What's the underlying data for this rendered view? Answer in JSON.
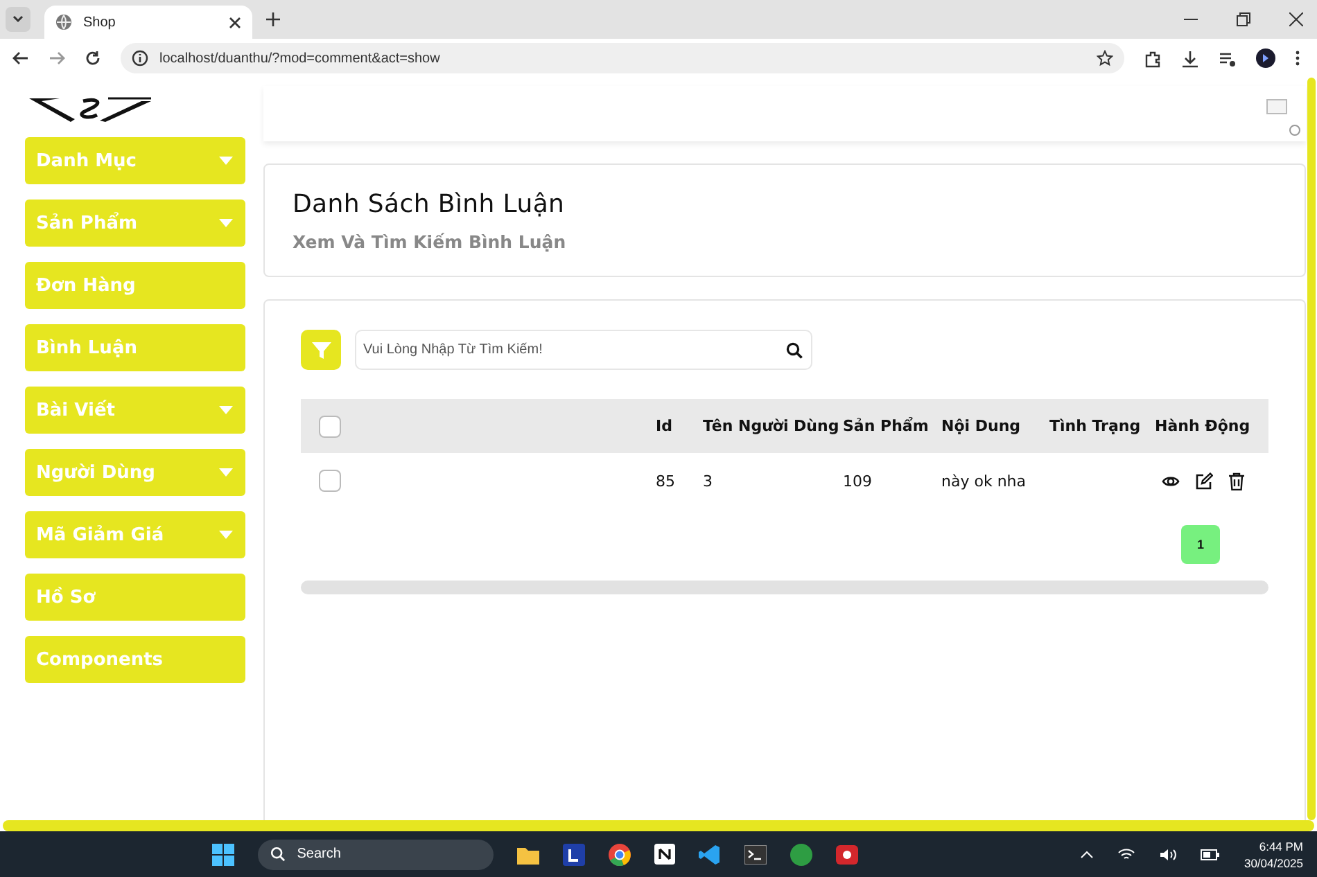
{
  "browser": {
    "tab_title": "Shop",
    "url": "localhost/duanthu/?mod=comment&act=show"
  },
  "sidebar": {
    "items": [
      {
        "label": "Danh Mục",
        "has_caret": true
      },
      {
        "label": "Sản Phẩm",
        "has_caret": true
      },
      {
        "label": "Đơn Hàng",
        "has_caret": false
      },
      {
        "label": "Bình Luận",
        "has_caret": false
      },
      {
        "label": "Bài Viết",
        "has_caret": true
      },
      {
        "label": "Người Dùng",
        "has_caret": true
      },
      {
        "label": "Mã Giảm Giá",
        "has_caret": true
      },
      {
        "label": "Hồ Sơ",
        "has_caret": false
      },
      {
        "label": "Components",
        "has_caret": false
      }
    ]
  },
  "page_header": {
    "title": "Danh Sách Bình Luận",
    "subtitle": "Xem Và Tìm Kiếm Bình Luận"
  },
  "search": {
    "placeholder": "Vui Lòng Nhập Từ Tìm Kiếm!"
  },
  "table": {
    "select_all_checked": false,
    "columns": [
      "Id",
      "Tên Người Dùng",
      "Sản Phẩm",
      "Nội Dung",
      "Tình Trạng",
      "Hành Động"
    ],
    "rows": [
      {
        "checked": false,
        "cells": [
          "85",
          "3",
          "109",
          "này ok nha",
          ""
        ]
      }
    ]
  },
  "pagination": [
    {
      "label": "1",
      "selected": true
    }
  ],
  "taskbar": {
    "search_placeholder": "Search",
    "time": "6:44 PM",
    "date": "30/04/2025"
  }
}
